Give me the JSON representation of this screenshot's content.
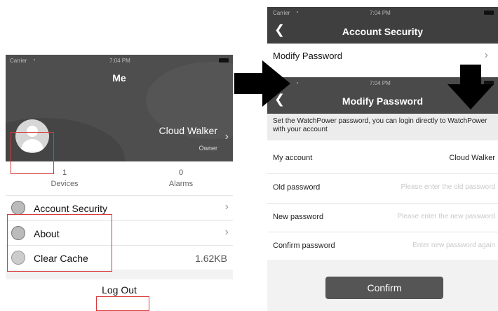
{
  "screen_me": {
    "status": {
      "carrier": "Carrier",
      "time": "7:04 PM"
    },
    "title": "Me",
    "user": {
      "name": "Cloud Walker",
      "role": "Owner"
    },
    "stats": [
      {
        "value": "1",
        "label": "Devices"
      },
      {
        "value": "0",
        "label": "Alarms"
      }
    ],
    "menu": [
      {
        "label": "Account Security",
        "icon": "shield-icon"
      },
      {
        "label": "About",
        "icon": "document-icon"
      },
      {
        "label": "Clear Cache",
        "icon": "broom-icon",
        "value": "1.62KB"
      }
    ],
    "logout_label": "Log Out"
  },
  "screen_account_security": {
    "status": {
      "carrier": "Carrier",
      "time": "7:04 PM"
    },
    "title": "Account Security",
    "items": [
      {
        "label": "Modify Password"
      }
    ]
  },
  "screen_modify_password": {
    "status": {
      "time": "7:04 PM"
    },
    "title": "Modify Password",
    "note": "Set the WatchPower password, you can login directly to WatchPower with your account",
    "fields": [
      {
        "label": "My account",
        "value": "Cloud Walker"
      },
      {
        "label": "Old password",
        "placeholder": "Please enter the old password"
      },
      {
        "label": "New password",
        "placeholder": "Please enter the new password"
      },
      {
        "label": "Confirm password",
        "placeholder": "Enter new password again"
      }
    ],
    "confirm_label": "Confirm"
  },
  "colors": {
    "header_dark": "#4e4e4e",
    "highlight": "#d63a3a",
    "arrow": "#000000"
  }
}
